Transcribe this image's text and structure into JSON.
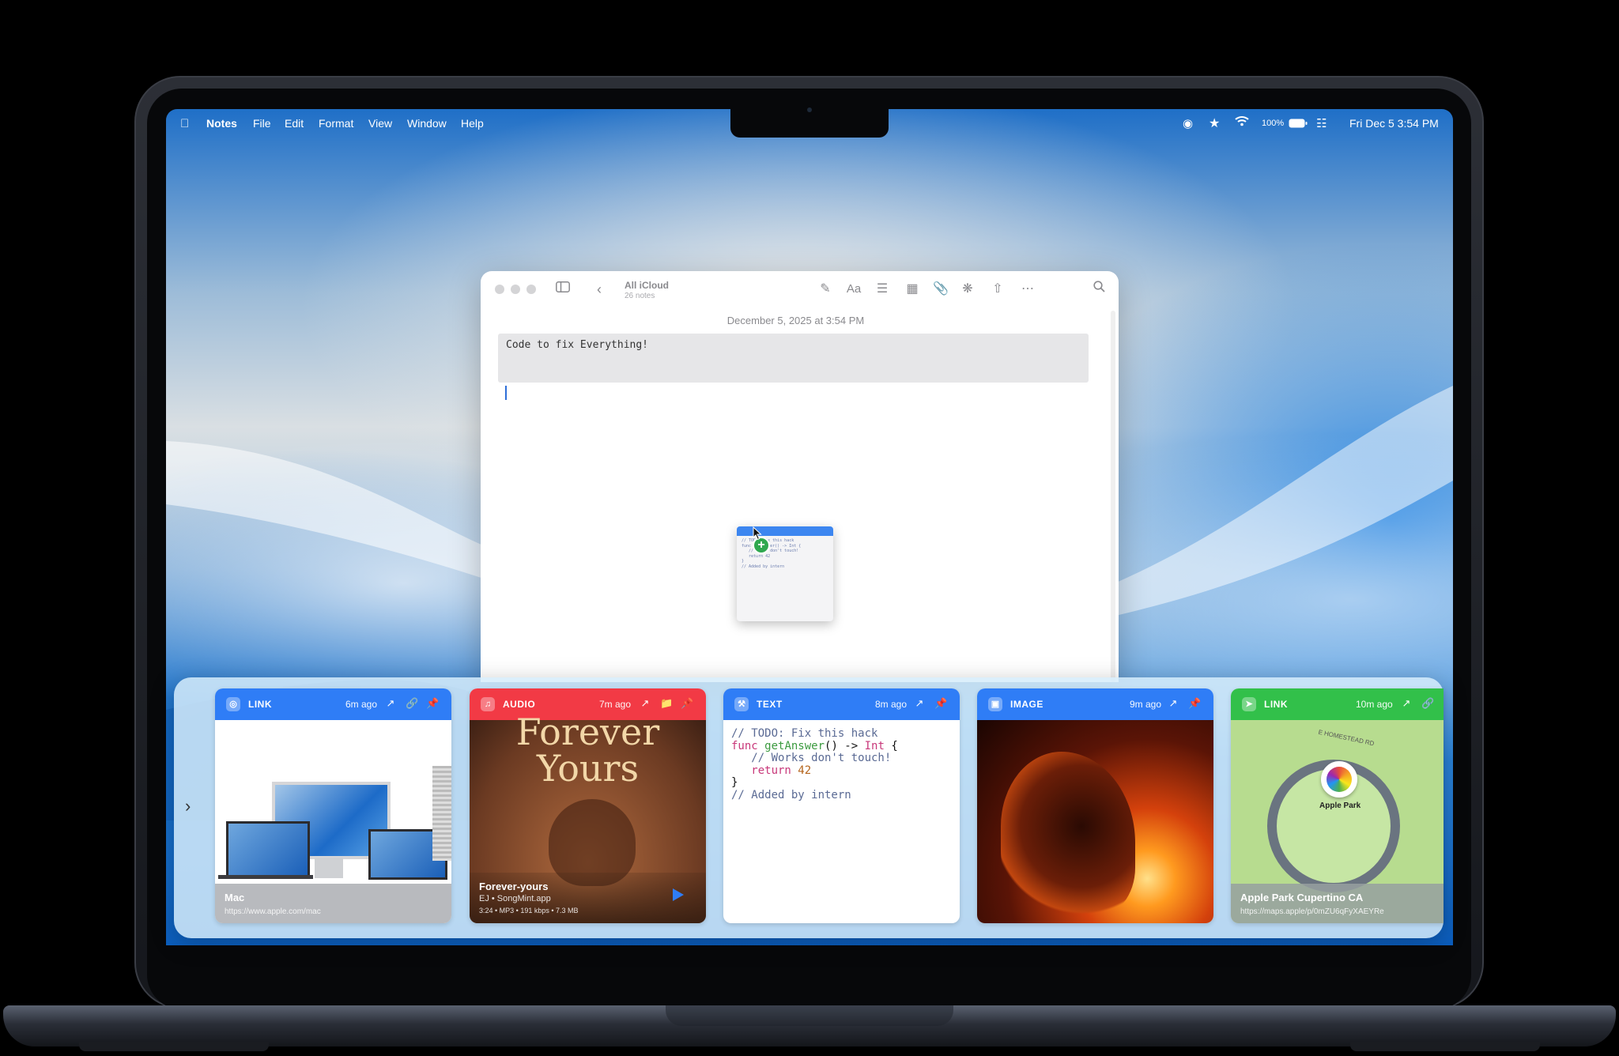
{
  "menubar": {
    "app": "Notes",
    "items": [
      "File",
      "Edit",
      "Format",
      "View",
      "Window",
      "Help"
    ],
    "battery": "100%",
    "datetime": "Fri Dec 5  3:54 PM"
  },
  "notes": {
    "folder": "All iCloud",
    "count": "26 notes",
    "date": "December 5, 2025 at 3:54 PM",
    "code_block": "Code to fix Everything!"
  },
  "drag_preview": {
    "lines": [
      "// TODO: Fix this hack",
      "func getAnswer() -> Int {",
      "   // Works don't touch!",
      "   return 42",
      "}",
      "// Added by intern"
    ]
  },
  "shelf": {
    "cards": [
      {
        "type": "LINK",
        "ago": "6m ago",
        "color": "#2f7df6",
        "title": "Mac",
        "subtitle": "https://www.apple.com/mac"
      },
      {
        "type": "AUDIO",
        "ago": "7m ago",
        "color": "#f23a45",
        "art_title_1": "Forever",
        "art_title_2": "Yours",
        "title": "Forever-yours",
        "subtitle": "EJ • SongMint.app",
        "meta": "3:24 • MP3 • 191 kbps • 7.3 MB"
      },
      {
        "type": "TEXT",
        "ago": "8m ago",
        "color": "#2f7df6",
        "code": {
          "l1": "// TODO: Fix this hack",
          "l2a": "func ",
          "l2b": "getAnswer",
          "l2c": "() -> ",
          "l2d": "Int",
          "l2e": " {",
          "l3": "   // Works don't touch!",
          "l4a": "   return ",
          "l4b": "42",
          "l5": "}",
          "l6": "// Added by intern"
        }
      },
      {
        "type": "IMAGE",
        "ago": "9m ago",
        "color": "#2f7df6"
      },
      {
        "type": "LINK",
        "ago": "10m ago",
        "color": "#32c04a",
        "map_road": "E HOMESTEAD RD",
        "map_label": "Apple Park",
        "title": "Apple Park Cupertino CA",
        "subtitle": "https://maps.apple/p/0mZU6qFyXAEYRe"
      }
    ]
  }
}
